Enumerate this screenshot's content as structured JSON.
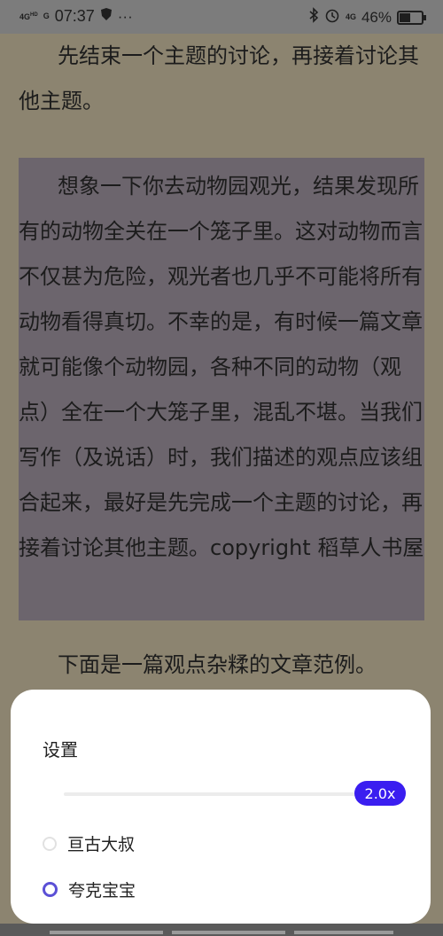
{
  "status_bar": {
    "signal1": "4G",
    "signal1_sup": "HD",
    "signal2": "G",
    "time": "07:37",
    "more": "···",
    "network": "4G",
    "battery": "46%"
  },
  "reader": {
    "paragraph1": "先结束一个主题的讨论，再接着讨论其他主题。",
    "paragraph2": "想象一下你去动物园观光，结果发现所有的动物全关在一个笼子里。这对动物而言不仅甚为危险，观光者也几乎不可能将所有动物看得真切。不幸的是，有时候一篇文章就可能像个动物园，各种不同的动物（观点）全在一个大笼子里，混乱不堪。当我们写作（及说话）时，我们描述的观点应该组合起来，最好是先完成一个主题的讨论，再接着讨论其他主题。copyright 稻草人书屋",
    "paragraph3": "下面是一篇观点杂糅的文章范例。"
  },
  "settings_panel": {
    "title": "设置",
    "speed_label": "2.0x",
    "options": [
      {
        "label": "亘古大叔",
        "selected": false
      },
      {
        "label": "夸克宝宝",
        "selected": true
      }
    ]
  },
  "colors": {
    "accent": "#3a1ef0",
    "radio_selected": "#5b50d6"
  }
}
